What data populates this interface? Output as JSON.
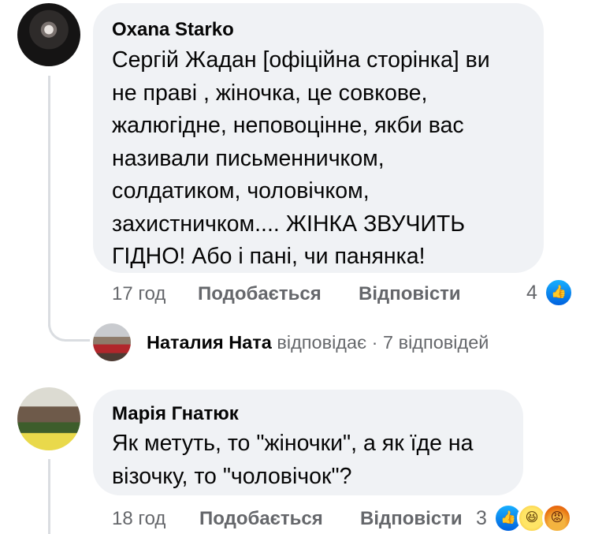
{
  "comments": [
    {
      "author": "Oxana Starko",
      "lines": [
        "Сергій Жадан [офіційна сторінка] ви",
        "не праві , жіночка, це совкове,",
        "жалюгідне, неповоцінне, якби вас",
        "називали письменничком,",
        "солдатиком, чоловічком,",
        "захистничком.... ЖІНКА ЗВУЧИТЬ",
        "ГІДНО! Або і пані, чи панянка!"
      ],
      "time": "17 год",
      "like_label": "Подобається",
      "reply_label": "Відповісти",
      "reaction_count": "4",
      "reaction_icons": [
        "like-icon"
      ]
    },
    {
      "author": "Марія Гнатюк",
      "lines": [
        "Як метуть, то \"жіночки\", а як їде на",
        "візочку, то \"чоловічок\"?"
      ],
      "time": "18 год",
      "like_label": "Подобається",
      "reply_label": "Відповісти",
      "reaction_count": "3",
      "reaction_icons": [
        "like-icon",
        "haha-icon",
        "angry-icon"
      ]
    }
  ],
  "replies_summary": {
    "name": "Наталия Ната",
    "verb": "відповідає",
    "separator": "·",
    "count_text": "7 відповідей"
  },
  "colors": {
    "bubble": "#f0f2f5",
    "meta_text": "#65676b",
    "thread_line": "#dadde1",
    "like_blue": "#0866ff"
  }
}
